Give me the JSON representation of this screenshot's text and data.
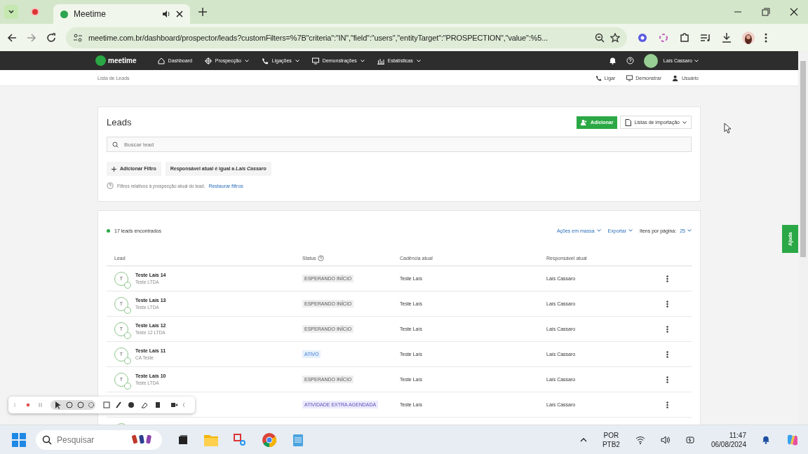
{
  "browser": {
    "tabs": [
      {
        "title": "Meetime",
        "selected": true
      }
    ],
    "url": "meetime.com.br/dashboard/prospector/leads?customFilters=%7B\"criteria\":\"IN\",\"field\":\"users\",\"entityTarget\":\"PROSPECTION\",\"value\":%5..."
  },
  "nav": {
    "logo": "meetime",
    "items": [
      {
        "label": "Dashboard",
        "dropdown": false
      },
      {
        "label": "Prospecção",
        "dropdown": true
      },
      {
        "label": "Ligações",
        "dropdown": true
      },
      {
        "label": "Demonstrações",
        "dropdown": true
      },
      {
        "label": "Estatísticas",
        "dropdown": true
      }
    ],
    "user": "Laís Cassaro"
  },
  "subbar": {
    "breadcrumb": "Lista de Leads",
    "actions": [
      "Ligar",
      "Demonstrar",
      "Usuário"
    ]
  },
  "leads_panel": {
    "title": "Leads",
    "add_button": "Adicionar",
    "import_button": "Listas de importação",
    "search": {
      "placeholder": "Buscar lead"
    },
    "add_filter": "Adicionar Filtro",
    "filter_chip": "Responsável atual é igual a *Laís Cassaro*",
    "hint": "Filtros relativos à prospecção atual do lead.",
    "restore_link": "Restaurar filtros"
  },
  "results": {
    "count": "17 leads encontrados",
    "bulk_actions": "Ações em massa",
    "export": "Exportar",
    "per_page_label": "Itens por página:",
    "per_page": "25",
    "columns": [
      "Lead",
      "Status",
      "Cadência atual",
      "Responsável atual"
    ],
    "rows": [
      {
        "avatar": "T",
        "name": "Teste Laís 14",
        "company": "Teste LTDA",
        "status": "ESPERANDO INÍCIO",
        "kind": "waiting",
        "cadence": "Teste Laís",
        "owner": "Laís Cassaro"
      },
      {
        "avatar": "T",
        "name": "Teste Laís 13",
        "company": "Teste LTDA",
        "status": "ESPERANDO INÍCIO",
        "kind": "waiting",
        "cadence": "Teste Laís",
        "owner": "Laís Cassaro"
      },
      {
        "avatar": "T",
        "name": "Teste Laís 12",
        "company": "Teste 12 LTDA",
        "status": "ESPERANDO INÍCIO",
        "kind": "waiting",
        "cadence": "Teste Laís",
        "owner": "Laís Cassaro"
      },
      {
        "avatar": "T",
        "name": "Teste Laís 11",
        "company": "CA Teste",
        "status": "ATIVO",
        "kind": "active",
        "cadence": "Teste Laís",
        "owner": "Laís Cassaro"
      },
      {
        "avatar": "T",
        "name": "Teste Laís 10",
        "company": "Teste LTDA",
        "status": "ESPERANDO INÍCIO",
        "kind": "waiting",
        "cadence": "Teste Laís",
        "owner": "Laís Cassaro"
      },
      {
        "status": "ATIVIDADE EXTRA AGENDADA",
        "kind": "extra",
        "cadence": "Teste Laís",
        "owner": "Laís Cassaro"
      }
    ]
  },
  "help_tab": "Ajuda",
  "taskbar": {
    "search": {
      "placeholder": "Pesquisar"
    },
    "language": "POR",
    "layout": "PTB2",
    "time": "11:47",
    "date": "06/08/2024"
  }
}
